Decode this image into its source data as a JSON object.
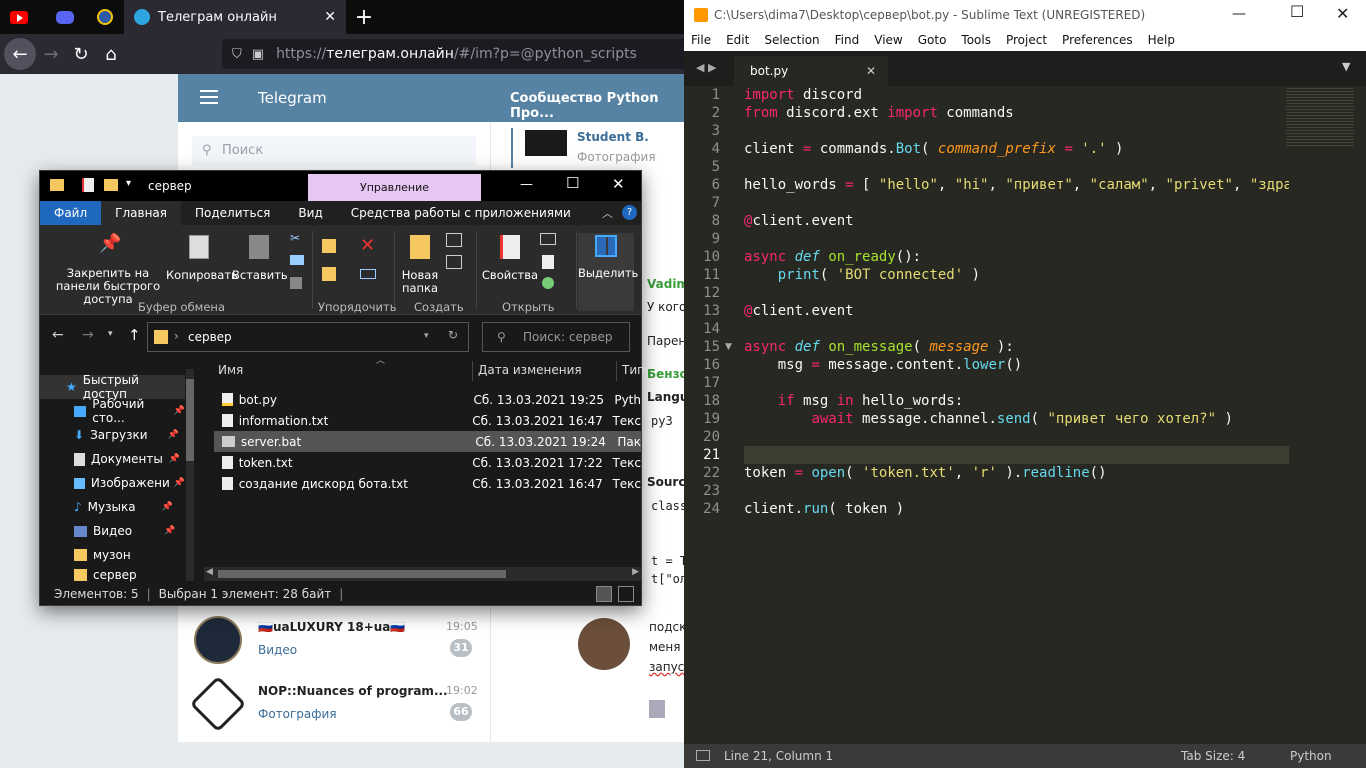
{
  "browser": {
    "tab_title": "Телеграм онлайн",
    "url_host": "телеграм.онлайн",
    "url_path": "/#/im?p=@python_scripts",
    "url_prefix": "https://"
  },
  "telegram": {
    "app_title": "Telegram",
    "chat_title": "Сообщество Python Про...",
    "search_placeholder": "Поиск",
    "pinned_name": "Student B.",
    "pinned_sub": "Фотография",
    "chats": [
      {
        "name": "🇷🇺uaLUXURY 18+ua🇷🇺",
        "preview": "Видео",
        "time": "19:05",
        "badge": "31"
      },
      {
        "name": "NOP::Nuances of program...",
        "preview": "Фотография",
        "time": "19:02",
        "badge": "66"
      }
    ],
    "msg_fragments": [
      "Vadim",
      "У кого",
      "Парен",
      "Бензо",
      "Langu",
      "py3",
      "Sourc",
      "class",
      "t = T",
      "t[\"ол"
    ],
    "msg_bottom": [
      "подска",
      "меня",
      "запуск"
    ]
  },
  "explorer": {
    "title": "сервер",
    "manage_label": "Управление",
    "menu": [
      "Файл",
      "Главная",
      "Поделиться",
      "Вид",
      "Средства работы с приложениями"
    ],
    "ribbon": {
      "pin": "Закрепить на панели быстрого доступа",
      "copy": "Копировать",
      "paste": "Вставить",
      "new_folder": "Новая папка",
      "properties": "Свойства",
      "select": "Выделить",
      "groups": [
        "Буфер обмена",
        "Упорядочить",
        "Создать",
        "Открыть"
      ]
    },
    "address": "сервер",
    "search_placeholder": "Поиск: сервер",
    "nav": [
      {
        "label": "Быстрый доступ"
      },
      {
        "label": "Рабочий сто..."
      },
      {
        "label": "Загрузки"
      },
      {
        "label": "Документы"
      },
      {
        "label": "Изображени"
      },
      {
        "label": "Музыка"
      },
      {
        "label": "Видео"
      },
      {
        "label": "музон"
      },
      {
        "label": "сервер"
      }
    ],
    "columns": [
      "Имя",
      "Дата изменения",
      "Тип"
    ],
    "files": [
      {
        "name": "bot.py",
        "date": "Сб. 13.03.2021 19:25",
        "type": "Pyth"
      },
      {
        "name": "information.txt",
        "date": "Сб. 13.03.2021 16:47",
        "type": "Текс"
      },
      {
        "name": "server.bat",
        "date": "Сб. 13.03.2021 19:24",
        "type": "Пак"
      },
      {
        "name": "token.txt",
        "date": "Сб. 13.03.2021 17:22",
        "type": "Текс"
      },
      {
        "name": "создание дискорд бота.txt",
        "date": "Сб. 13.03.2021 16:47",
        "type": "Текс"
      }
    ],
    "status_count": "Элементов: 5",
    "status_selected": "Выбран 1 элемент: 28 байт"
  },
  "sublime": {
    "title": "C:\\Users\\dima7\\Desktop\\сервер\\bot.py - Sublime Text (UNREGISTERED)",
    "menu": [
      "File",
      "Edit",
      "Selection",
      "Find",
      "View",
      "Goto",
      "Tools",
      "Project",
      "Preferences",
      "Help"
    ],
    "tab": "bot.py",
    "status_pos": "Line 21, Column 1",
    "status_tab": "Tab Size: 4",
    "status_syntax": "Python"
  }
}
